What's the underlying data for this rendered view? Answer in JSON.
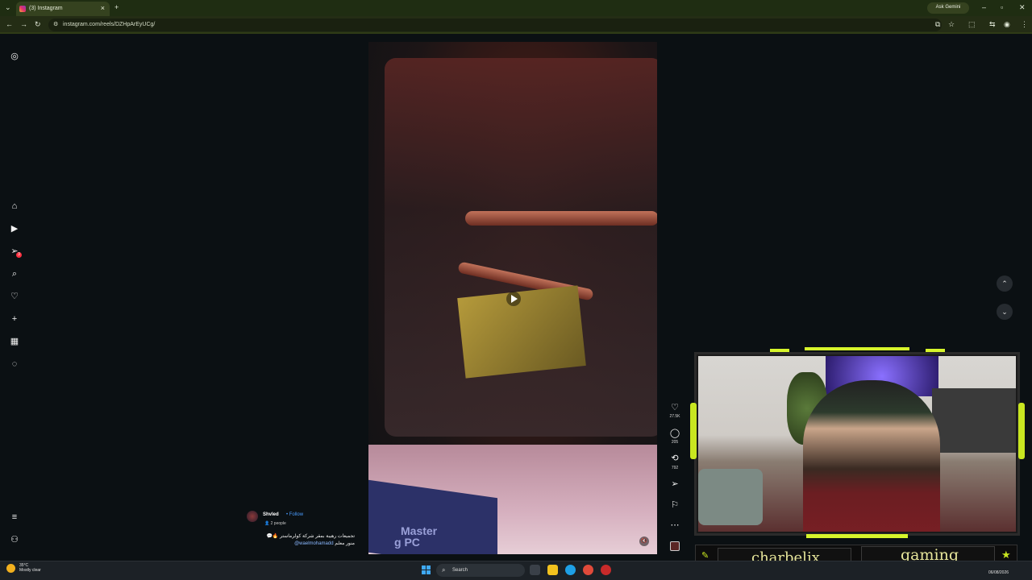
{
  "browser": {
    "tab_title": "(3) Instagram",
    "tab_close": "×",
    "new_tab": "+",
    "url": "instagram.com/reels/DZHpArEyUCg/",
    "ask_gemini": "Ask Gemini",
    "window_controls": {
      "minimize": "–",
      "maximize": "▫",
      "close": "✕"
    }
  },
  "sidebar": {
    "notification_count": "3",
    "icons": [
      "instagram-logo-icon",
      "home-icon",
      "reels-icon",
      "messages-icon",
      "search-icon",
      "heart-icon",
      "create-icon",
      "dashboard-icon",
      "profile-icon",
      "menu-icon",
      "meta-icon"
    ]
  },
  "reel": {
    "sign_text_line1": "Master",
    "sign_text_line2": "g PC",
    "username": "Shvled",
    "follow": "• Follow",
    "people": "2 people",
    "caption_line1": "تجميعات رهيبة بمقر شركة كولرماستر 🔥💬",
    "caption_line2_prefix": "منور معلم ",
    "caption_mention": "@waelmohamadd",
    "likes": "27.5K",
    "comments": "205",
    "reposts": "792"
  },
  "overlay": {
    "streamer_name": "charbelix",
    "category": "gaming"
  },
  "taskbar": {
    "weather_temp": "35°C",
    "weather_desc": "Mostly clear",
    "search_label": "Search",
    "date": "06/08/2026"
  },
  "colors": {
    "accent_green": "#c8e620",
    "overlay_text": "#e7e69b",
    "link_blue": "#4a9cff",
    "badge_red": "#ff3040"
  }
}
